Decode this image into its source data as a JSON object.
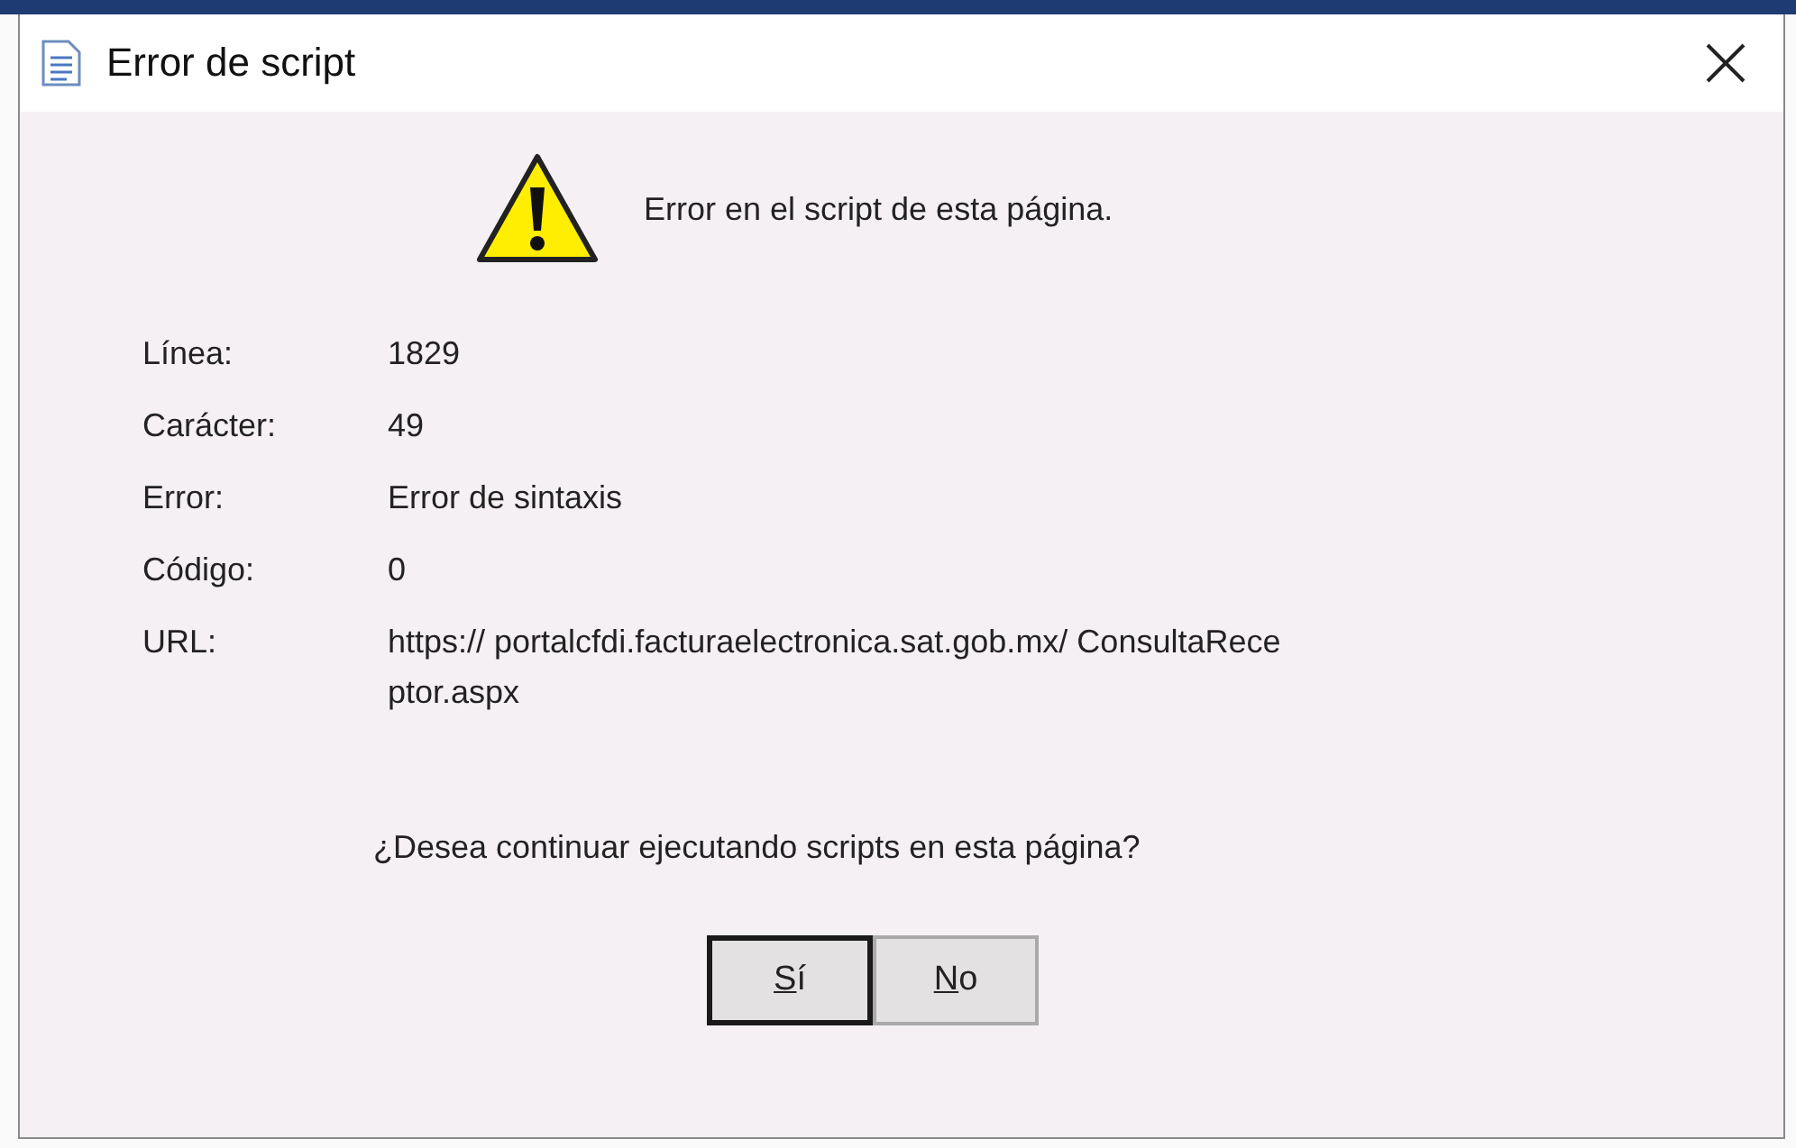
{
  "window": {
    "title": "Error de script"
  },
  "message": "Error en el script de esta página.",
  "details": [
    {
      "label": "Línea:",
      "value": [
        "1829"
      ]
    },
    {
      "label": "Carácter:",
      "value": [
        "49"
      ]
    },
    {
      "label": "Error:",
      "value": [
        "Error de sintaxis"
      ]
    },
    {
      "label": "Código:",
      "value": [
        "0"
      ]
    },
    {
      "label": "URL:",
      "value": [
        "https:// portalcfdi.facturaelectronica.sat.gob.mx/ ConsultaRece",
        "ptor.aspx"
      ]
    }
  ],
  "question": "¿Desea continuar ejecutando scripts en esta página?",
  "buttons": [
    {
      "label": "Sí",
      "selected": true
    },
    {
      "label": "No",
      "selected": false
    }
  ]
}
